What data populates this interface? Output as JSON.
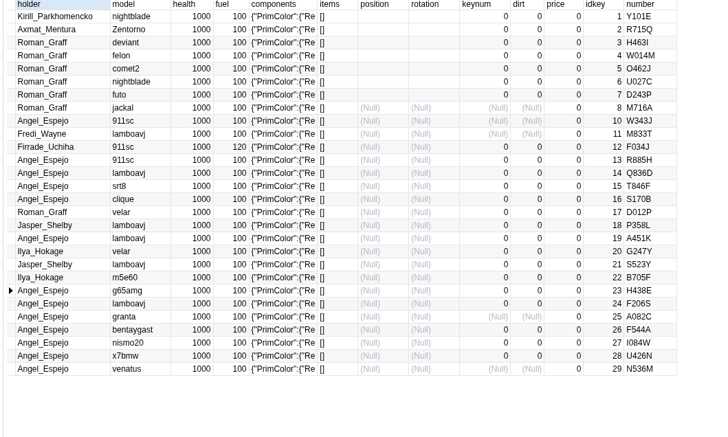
{
  "table": {
    "columns": [
      {
        "label": "holder",
        "kind": "text",
        "selected": true
      },
      {
        "label": "model",
        "kind": "text",
        "selected": false
      },
      {
        "label": "health",
        "kind": "number",
        "selected": false
      },
      {
        "label": "fuel",
        "kind": "number",
        "selected": false
      },
      {
        "label": "components",
        "kind": "text",
        "selected": false
      },
      {
        "label": "items",
        "kind": "text",
        "selected": false
      },
      {
        "label": "position",
        "kind": "text",
        "selected": false
      },
      {
        "label": "rotation",
        "kind": "text",
        "selected": false
      },
      {
        "label": "keynum",
        "kind": "number",
        "selected": false
      },
      {
        "label": "dirt",
        "kind": "number",
        "selected": false
      },
      {
        "label": "price",
        "kind": "number",
        "selected": false
      },
      {
        "label": "idkey",
        "kind": "number",
        "selected": false
      },
      {
        "label": "number",
        "kind": "text",
        "selected": false
      }
    ],
    "rows": [
      {
        "selected": false,
        "cells": [
          "Kirill_Parkhomencko",
          "nightblade",
          "1000",
          "100",
          "{\"PrimColor\":{\"Re",
          "[]",
          null,
          null,
          "0",
          "0",
          "0",
          "1",
          "Y101E"
        ]
      },
      {
        "selected": false,
        "cells": [
          "Axmat_Mentura",
          "Zentorno",
          "1000",
          "100",
          "{\"PrimColor\":{\"Re",
          "[]",
          null,
          null,
          "0",
          "0",
          "0",
          "2",
          "R715Q"
        ]
      },
      {
        "selected": false,
        "cells": [
          "Roman_Graff",
          "deviant",
          "1000",
          "100",
          "{\"PrimColor\":{\"Re",
          "[]",
          null,
          null,
          "0",
          "0",
          "0",
          "3",
          "H463I"
        ]
      },
      {
        "selected": false,
        "cells": [
          "Roman_Graff",
          "felon",
          "1000",
          "100",
          "{\"PrimColor\":{\"Re",
          "[]",
          null,
          null,
          "0",
          "0",
          "0",
          "4",
          "W014M"
        ]
      },
      {
        "selected": false,
        "cells": [
          "Roman_Graff",
          "comet2",
          "1000",
          "100",
          "{\"PrimColor\":{\"Re",
          "[]",
          null,
          null,
          "0",
          "0",
          "0",
          "5",
          "O462J"
        ]
      },
      {
        "selected": false,
        "cells": [
          "Roman_Graff",
          "nightblade",
          "1000",
          "100",
          "{\"PrimColor\":{\"Re",
          "[]",
          null,
          null,
          "0",
          "0",
          "0",
          "6",
          "U027C"
        ]
      },
      {
        "selected": false,
        "cells": [
          "Roman_Graff",
          "futo",
          "1000",
          "100",
          "{\"PrimColor\":{\"Re",
          "[]",
          null,
          null,
          "0",
          "0",
          "0",
          "7",
          "D243P"
        ]
      },
      {
        "selected": false,
        "cells": [
          "Roman_Graff",
          "jackal",
          "1000",
          "100",
          "{\"PrimColor\":{\"Re",
          "[]",
          {
            "text": "(Null)",
            "null": true
          },
          {
            "text": "(Null)",
            "null": true
          },
          {
            "text": "(Null)",
            "null": true
          },
          {
            "text": "(Null)",
            "null": true
          },
          "0",
          "8",
          "M716A"
        ]
      },
      {
        "selected": false,
        "cells": [
          "Angel_Espejo",
          "911sc",
          "1000",
          "100",
          "{\"PrimColor\":{\"Re",
          "[]",
          {
            "text": "(Null)",
            "null": true
          },
          {
            "text": "(Null)",
            "null": true
          },
          {
            "text": "(Null)",
            "null": true
          },
          {
            "text": "(Null)",
            "null": true
          },
          "0",
          "10",
          "W343J"
        ]
      },
      {
        "selected": false,
        "cells": [
          "Fredi_Wayne",
          "lamboavj",
          "1000",
          "100",
          "{\"PrimColor\":{\"Re",
          "[]",
          {
            "text": "(Null)",
            "null": true
          },
          {
            "text": "(Null)",
            "null": true
          },
          {
            "text": "(Null)",
            "null": true
          },
          {
            "text": "(Null)",
            "null": true
          },
          "0",
          "11",
          "M833T"
        ]
      },
      {
        "selected": false,
        "cells": [
          "Firrade_Uchiha",
          "911sc",
          "1000",
          "120",
          "{\"PrimColor\":{\"Re",
          "[]",
          {
            "text": "(Null)",
            "null": true
          },
          {
            "text": "(Null)",
            "null": true
          },
          "0",
          "0",
          "0",
          "12",
          "F034J"
        ]
      },
      {
        "selected": false,
        "cells": [
          "Angel_Espejo",
          "911sc",
          "1000",
          "100",
          "{\"PrimColor\":{\"Re",
          "[]",
          {
            "text": "(Null)",
            "null": true
          },
          {
            "text": "(Null)",
            "null": true
          },
          "0",
          "0",
          "0",
          "13",
          "R885H"
        ]
      },
      {
        "selected": false,
        "cells": [
          "Angel_Espejo",
          "lamboavj",
          "1000",
          "100",
          "{\"PrimColor\":{\"Re",
          "[]",
          {
            "text": "(Null)",
            "null": true
          },
          {
            "text": "(Null)",
            "null": true
          },
          "0",
          "0",
          "0",
          "14",
          "Q836D"
        ]
      },
      {
        "selected": false,
        "cells": [
          "Angel_Espejo",
          "srt8",
          "1000",
          "100",
          "{\"PrimColor\":{\"Re",
          "[]",
          {
            "text": "(Null)",
            "null": true
          },
          {
            "text": "(Null)",
            "null": true
          },
          "0",
          "0",
          "0",
          "15",
          "T846F"
        ]
      },
      {
        "selected": false,
        "cells": [
          "Angel_Espejo",
          "clique",
          "1000",
          "100",
          "{\"PrimColor\":{\"Re",
          "[]",
          {
            "text": "(Null)",
            "null": true
          },
          {
            "text": "(Null)",
            "null": true
          },
          "0",
          "0",
          "0",
          "16",
          "S170B"
        ]
      },
      {
        "selected": false,
        "cells": [
          "Roman_Graff",
          "velar",
          "1000",
          "100",
          "{\"PrimColor\":{\"Re",
          "[]",
          {
            "text": "(Null)",
            "null": true
          },
          {
            "text": "(Null)",
            "null": true
          },
          "0",
          "0",
          "0",
          "17",
          "D012P"
        ]
      },
      {
        "selected": false,
        "cells": [
          "Jasper_Shelby",
          "lamboavj",
          "1000",
          "100",
          "{\"PrimColor\":{\"Re",
          "[]",
          {
            "text": "(Null)",
            "null": true
          },
          {
            "text": "(Null)",
            "null": true
          },
          "0",
          "0",
          "0",
          "18",
          "P358L"
        ]
      },
      {
        "selected": false,
        "cells": [
          "Angel_Espejo",
          "lamboavj",
          "1000",
          "100",
          "{\"PrimColor\":{\"Re",
          "[]",
          {
            "text": "(Null)",
            "null": true
          },
          {
            "text": "(Null)",
            "null": true
          },
          "0",
          "0",
          "0",
          "19",
          "A451K"
        ]
      },
      {
        "selected": false,
        "cells": [
          "Ilya_Hokage",
          "velar",
          "1000",
          "100",
          "{\"PrimColor\":{\"Re",
          "[]",
          {
            "text": "(Null)",
            "null": true
          },
          {
            "text": "(Null)",
            "null": true
          },
          "0",
          "0",
          "0",
          "20",
          "G247Y"
        ]
      },
      {
        "selected": false,
        "cells": [
          "Jasper_Shelby",
          "lamboavj",
          "1000",
          "100",
          "{\"PrimColor\":{\"Re",
          "[]",
          {
            "text": "(Null)",
            "null": true
          },
          {
            "text": "(Null)",
            "null": true
          },
          "0",
          "0",
          "0",
          "21",
          "S523Y"
        ]
      },
      {
        "selected": false,
        "cells": [
          "Ilya_Hokage",
          "m5e60",
          "1000",
          "100",
          "{\"PrimColor\":{\"Re",
          "[]",
          {
            "text": "(Null)",
            "null": true
          },
          {
            "text": "(Null)",
            "null": true
          },
          "0",
          "0",
          "0",
          "22",
          "B705F"
        ]
      },
      {
        "selected": true,
        "cells": [
          "Angel_Espejo",
          "g65amg",
          "1000",
          "100",
          "{\"PrimColor\":{\"Re",
          "[]",
          {
            "text": "(Null)",
            "null": true
          },
          {
            "text": "(Null)",
            "null": true
          },
          "0",
          "0",
          "0",
          "23",
          "H438E"
        ]
      },
      {
        "selected": false,
        "cells": [
          "Angel_Espejo",
          "lamboavj",
          "1000",
          "100",
          "{\"PrimColor\":{\"Re",
          "[]",
          {
            "text": "(Null)",
            "null": true
          },
          {
            "text": "(Null)",
            "null": true
          },
          "0",
          "0",
          "0",
          "24",
          "F206S"
        ]
      },
      {
        "selected": false,
        "cells": [
          "Angel_Espejo",
          "granta",
          "1000",
          "100",
          "{\"PrimColor\":{\"Re",
          "[]",
          {
            "text": "(Null)",
            "null": true
          },
          {
            "text": "(Null)",
            "null": true
          },
          {
            "text": "(Null)",
            "null": true
          },
          {
            "text": "(Null)",
            "null": true
          },
          "0",
          "25",
          "A082C"
        ]
      },
      {
        "selected": false,
        "cells": [
          "Angel_Espejo",
          "bentaygast",
          "1000",
          "100",
          "{\"PrimColor\":{\"Re",
          "[]",
          {
            "text": "(Null)",
            "null": true
          },
          {
            "text": "(Null)",
            "null": true
          },
          "0",
          "0",
          "0",
          "26",
          "F544A"
        ]
      },
      {
        "selected": false,
        "cells": [
          "Angel_Espejo",
          "nismo20",
          "1000",
          "100",
          "{\"PrimColor\":{\"Re",
          "[]",
          {
            "text": "(Null)",
            "null": true
          },
          {
            "text": "(Null)",
            "null": true
          },
          "0",
          "0",
          "0",
          "27",
          "I084W"
        ]
      },
      {
        "selected": false,
        "cells": [
          "Angel_Espejo",
          "x7bmw",
          "1000",
          "100",
          "{\"PrimColor\":{\"Re",
          "[]",
          {
            "text": "(Null)",
            "null": true
          },
          {
            "text": "(Null)",
            "null": true
          },
          "0",
          "0",
          "0",
          "28",
          "U426N"
        ]
      },
      {
        "selected": false,
        "cells": [
          "Angel_Espejo",
          "venatus",
          "1000",
          "100",
          "{\"PrimColor\":{\"Re",
          "[]",
          {
            "text": "(Null)",
            "null": true
          },
          {
            "text": "(Null)",
            "null": true
          },
          {
            "text": "(Null)",
            "null": true
          },
          {
            "text": "(Null)",
            "null": true
          },
          "0",
          "29",
          "N536M"
        ]
      }
    ]
  }
}
